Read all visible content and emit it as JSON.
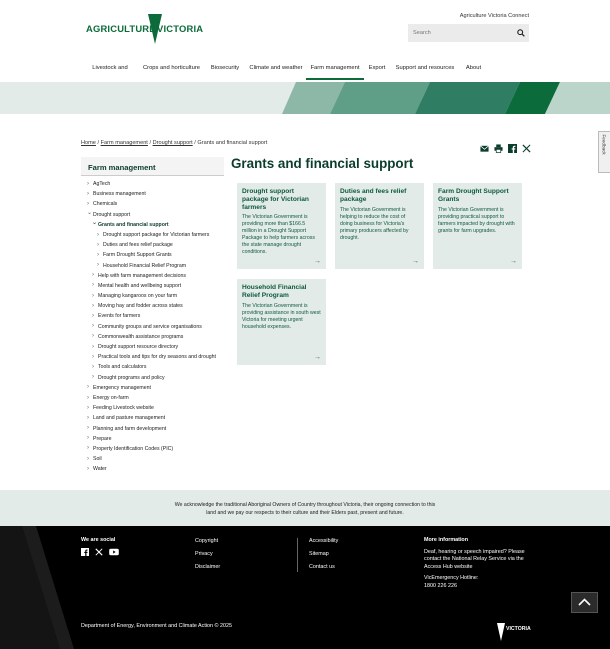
{
  "header": {
    "logo_left": "AGRICULTURE",
    "logo_right": "VICTORIA",
    "connect_link": "Agriculture Victoria Connect",
    "search_placeholder": "Search"
  },
  "nav": [
    "Livestock and animals",
    "Crops and horticulture",
    "Biosecurity",
    "Climate and weather",
    "Farm management",
    "Export",
    "Support and resources",
    "About"
  ],
  "breadcrumb": {
    "home": "Home",
    "farm_management": "Farm management",
    "drought_support": "Drought support",
    "current": "Grants and financial support",
    "sep": "/"
  },
  "share_icons": [
    "email-icon",
    "print-icon",
    "facebook-icon",
    "x-icon"
  ],
  "sidebar": {
    "title": "Farm management",
    "items": [
      "AgTech",
      "Business management",
      "Chemicals",
      "Drought support",
      "Grants and financial support",
      "Drought support package for Victorian farmers",
      "Duties and fees relief package",
      "Farm Drought Support Grants",
      "Household Financial Relief Program",
      "Help with farm management decisions",
      "Mental health and wellbeing support",
      "Managing kangaroos on your farm",
      "Moving hay and fodder across states",
      "Events for farmers",
      "Community groups and service organisations",
      "Commonwealth assistance programs",
      "Drought support resource directory",
      "Practical tools and tips for dry seasons and drought",
      "Tools and calculators",
      "Drought programs and policy",
      "Emergency management",
      "Energy on-farm",
      "Feeding Livestock website",
      "Land and pasture management",
      "Planning and farm development",
      "Prepare",
      "Property Identification Codes (PIC)",
      "Soil",
      "Water"
    ]
  },
  "main": {
    "title": "Grants and financial support",
    "cards": [
      {
        "title": "Drought support package for Victorian farmers",
        "text": "The Victorian Government is providing more than $166.5 million in a Drought Support Package to help farmers across the state manage drought conditions."
      },
      {
        "title": "Duties and fees relief package",
        "text": "The Victorian Government is helping to reduce the cost of doing business for Victoria's primary producers affected by drought."
      },
      {
        "title": "Farm Drought Support Grants",
        "text": "The Victorian Government is providing practical support to farmers impacted by drought with grants for farm upgrades."
      },
      {
        "title": "Household Financial Relief Program",
        "text": "The Victorian Government is providing assistance in south west Victoria for meeting urgent household expenses."
      }
    ],
    "arrow": "→"
  },
  "acknowledgement": {
    "line1": "We acknowledge the traditional Aboriginal Owners of Country throughout Victoria, their ongoing connection to this",
    "line2": "land and we pay our respects to their culture and their Elders past, present and future."
  },
  "footer": {
    "social_title": "We are social",
    "links_col1": [
      "Copyright",
      "Privacy",
      "Disclaimer"
    ],
    "links_col2": [
      "Accessibility",
      "Sitemap",
      "Contact us"
    ],
    "info_title": "More information",
    "info_text": "Deaf, hearing or speech impaired? Please contact the National Relay Service via the Access Hub website",
    "hotline_label": "VicEmergency Hotline:",
    "hotline_number": "1800 226 226",
    "copyright": "Department of Energy, Environment and Climate Action © 2025",
    "logo_text": "VICTORIA"
  },
  "feedback_label": "Feedback",
  "colors": {
    "brand_green": "#0b6b3a",
    "dark_green": "#0b3d2b",
    "card_bg": "#e3ebe8"
  }
}
